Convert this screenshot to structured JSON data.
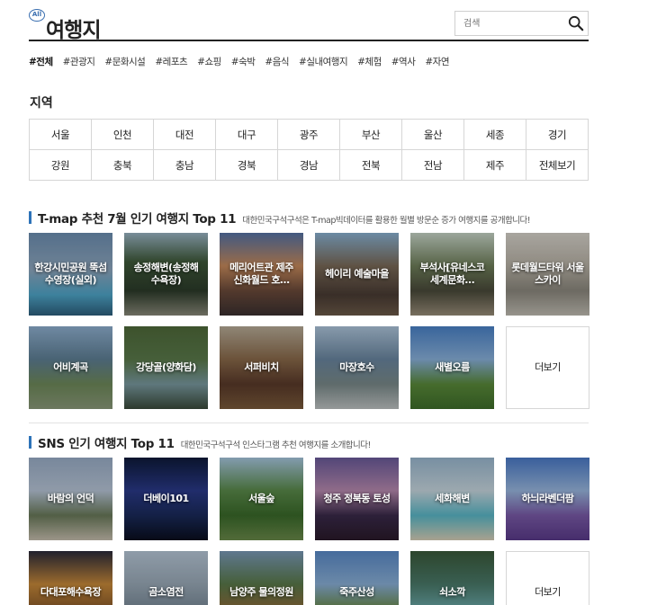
{
  "header": {
    "all_badge": "All",
    "title": "여행지",
    "search_placeholder": "검색"
  },
  "tags": [
    "#전체",
    "#관광지",
    "#문화시설",
    "#레포츠",
    "#쇼핑",
    "#숙박",
    "#음식",
    "#실내여행지",
    "#체험",
    "#역사",
    "#자연"
  ],
  "region": {
    "title": "지역",
    "items": [
      "서울",
      "인천",
      "대전",
      "대구",
      "광주",
      "부산",
      "울산",
      "세종",
      "경기",
      "강원",
      "충북",
      "충남",
      "경북",
      "경남",
      "전북",
      "전남",
      "제주",
      "전체보기"
    ]
  },
  "section1": {
    "title": "T-map 추천 7월 인기 여행지 Top 11",
    "desc": "대한민국구석구석은 T-map빅데이터를 활용한 월별 방문순 증가 여행지를 공개합니다!",
    "cards": [
      "한강시민공원 뚝섬수영장(실외)",
      "송정해변(송정해수욕장)",
      "메리어트관 제주 신화월드 호…",
      "헤이리 예술마을",
      "부석사[유네스코 세계문화…",
      "롯데월드타워 서울스카이",
      "어비계곡",
      "강당골(양화담)",
      "서퍼비치",
      "마장호수",
      "새별오름"
    ],
    "more": "더보기"
  },
  "section2": {
    "title": "SNS 인기 여행지 Top 11",
    "desc": "대한민국구석구석 인스타그램 추천 여행지를 소개합니다!",
    "cards": [
      "바람의 언덕",
      "더베이101",
      "서울숲",
      "청주 정북동 토성",
      "세화해변",
      "하늬라벤더팜",
      "다대포해수욕장",
      "곰소염전",
      "남양주 물의정원",
      "죽주산성",
      "쇠소깍"
    ],
    "more": "더보기"
  },
  "colors": {
    "accent": "#2d73b8",
    "border": "#d6d6d6"
  }
}
